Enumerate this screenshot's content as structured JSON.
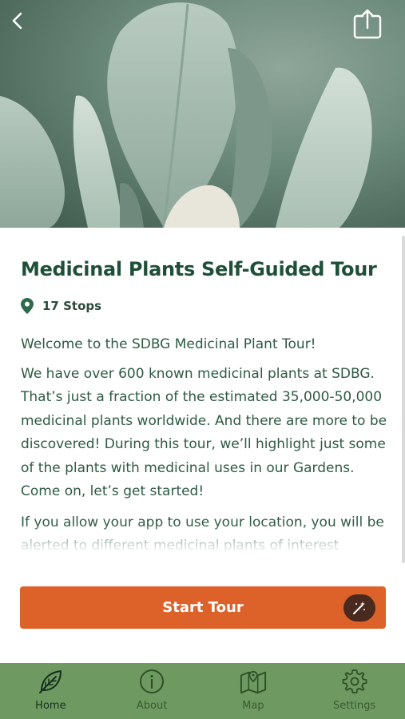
{
  "header": {
    "back_icon": "chevron-left-icon",
    "share_icon": "share-icon"
  },
  "tour": {
    "title": "Medicinal Plants Self-Guided Tour",
    "stops_icon": "map-pin-icon",
    "stops_label": "17 Stops",
    "welcome": "Welcome to the SDBG Medicinal Plant Tour!",
    "paragraph_1": "We have over 600 known medicinal plants at SDBG. That’s just a fraction of the estimated 35,000-50,000 medicinal plants worldwide. And there are more to be discovered! During this tour, we’ll highlight just some of the plants with medicinal uses in our Gardens. Come on, let’s get started!",
    "paragraph_2": "If you allow your app to use your location, you will be alerted to different medicinal plants of interest"
  },
  "actions": {
    "start_label": "Start Tour",
    "wand_icon": "magic-wand-icon"
  },
  "colors": {
    "title": "#1f4f38",
    "accent": "#dd622a",
    "tabbar": "#6e9a62"
  },
  "nav": {
    "tabs": [
      {
        "label": "Home",
        "icon": "leaf-icon",
        "active": true
      },
      {
        "label": "About",
        "icon": "info-icon",
        "active": false
      },
      {
        "label": "Map",
        "icon": "map-icon",
        "active": false
      },
      {
        "label": "Settings",
        "icon": "gear-icon",
        "active": false
      }
    ]
  }
}
